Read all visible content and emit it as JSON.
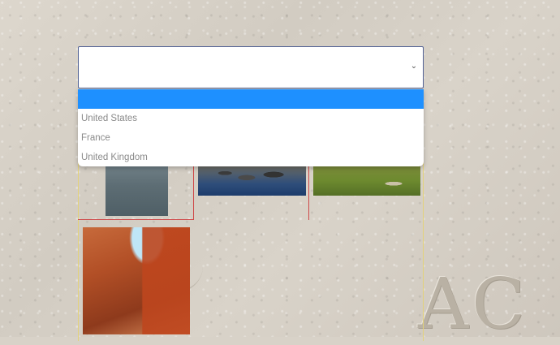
{
  "select": {
    "value": "",
    "arrow_icon": "chevron-down-icon"
  },
  "dropdown": {
    "options": [
      "",
      "United States",
      "France",
      "United Kingdom"
    ],
    "selected_index": 0,
    "highlight_color": "#1e90ff"
  },
  "gallery": {
    "images": [
      "lake",
      "rocks-in-water",
      "moss-and-stump",
      "red-canyon"
    ]
  },
  "background": {
    "graffiti_text": "AC"
  }
}
